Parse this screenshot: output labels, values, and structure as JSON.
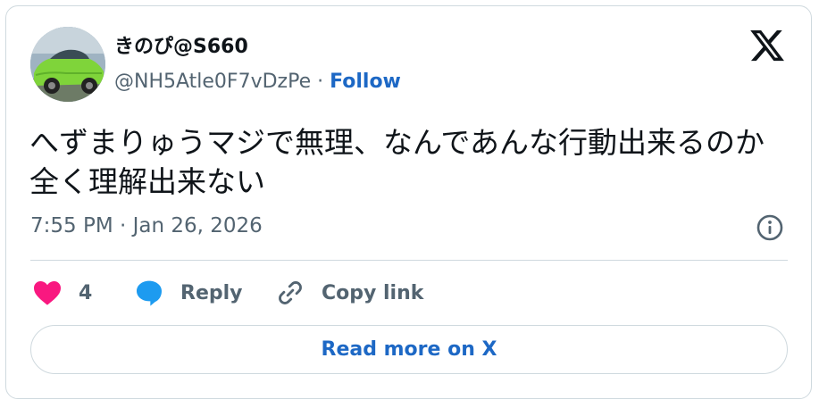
{
  "tweet": {
    "author_name": "きのぴ@S660",
    "handle": "@NH5Atle0F7vDzPe",
    "separator": "·",
    "follow_label": "Follow",
    "text": "へずまりゅうマジで無理、なんであんな行動出来るのか全く理解出来ない",
    "timestamp": "7:55 PM · Jan 26, 2026"
  },
  "actions": {
    "like_count": "4",
    "reply_label": "Reply",
    "copy_link_label": "Copy link"
  },
  "footer": {
    "read_more_label": "Read more on X"
  },
  "icons": {
    "logo": "x-logo-icon",
    "info": "info-icon",
    "like": "heart-icon",
    "reply": "speech-bubble-icon",
    "copy": "link-icon"
  },
  "colors": {
    "accent": "#1d68c5",
    "like": "#f91880",
    "reply": "#1d9bf0",
    "muted": "#536471",
    "border": "#cfd9de"
  }
}
